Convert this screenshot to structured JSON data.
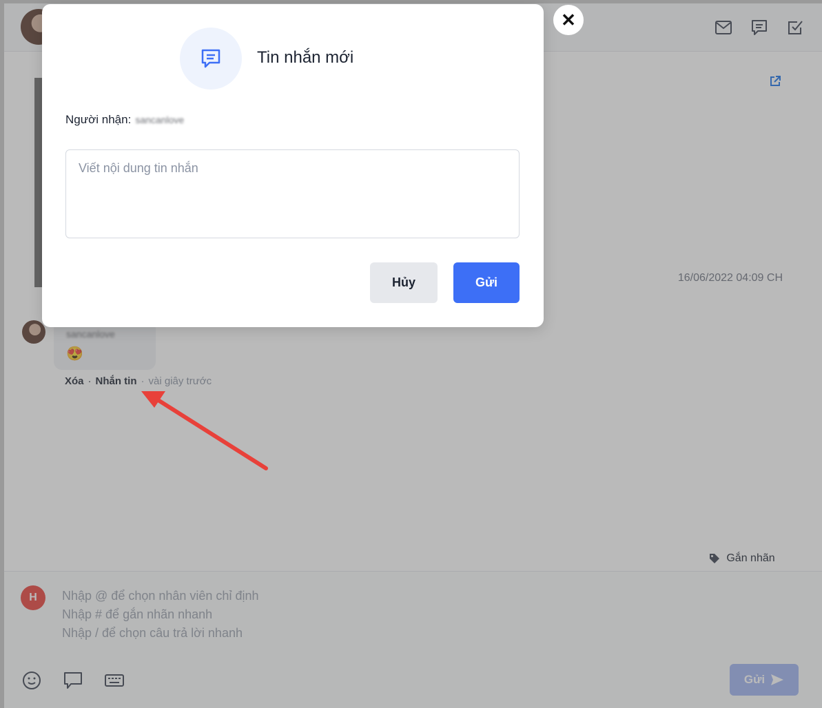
{
  "header": {
    "icons": [
      "mail-icon",
      "message-icon",
      "check-square-icon"
    ]
  },
  "post": {
    "timestamp": "16/06/2022 04:09 CH"
  },
  "comment": {
    "author": "sancanlove",
    "emoji": "😍",
    "delete_label": "Xóa",
    "separator": "·",
    "message_label": "Nhắn tin",
    "time": "vài giây trước"
  },
  "tag_button": {
    "label": "Gắn nhãn"
  },
  "composer": {
    "avatar_letter": "H",
    "hint_lines": [
      "Nhập @ để chọn nhân viên chỉ định",
      "Nhập # để gắn nhãn nhanh",
      "Nhập / để chọn câu trả lời nhanh"
    ],
    "send_label": "Gửi"
  },
  "modal": {
    "title": "Tin nhắn mới",
    "recipient_label": "Người nhận:",
    "recipient_name": "sancanlove",
    "input_placeholder": "Viết nội dung tin nhắn",
    "cancel_label": "Hủy",
    "send_label": "Gửi",
    "close_symbol": "✕"
  },
  "colors": {
    "primary": "#3d6ff6",
    "avatar_red": "#e8413a",
    "arrow": "#e8413a"
  }
}
